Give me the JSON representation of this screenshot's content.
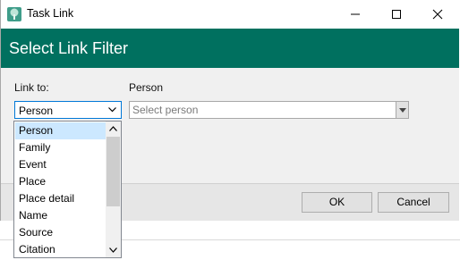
{
  "window": {
    "title": "Task Link",
    "app_icon": "tree-icon",
    "controls": [
      "minimize-icon",
      "maximize-icon",
      "close-icon"
    ]
  },
  "header": {
    "title": "Select Link Filter"
  },
  "form": {
    "link_to_label": "Link to:",
    "link_to_value": "Person",
    "person_label": "Person",
    "person_placeholder": "Select person"
  },
  "dropdown": {
    "items": [
      "Person",
      "Family",
      "Event",
      "Place",
      "Place detail",
      "Name",
      "Source",
      "Citation"
    ],
    "selected_index": 0
  },
  "buttons": {
    "ok": "OK",
    "cancel": "Cancel"
  },
  "colors": {
    "header_bg": "#00705f",
    "selection_bg": "#cce8ff",
    "focus_border": "#0078d7"
  }
}
